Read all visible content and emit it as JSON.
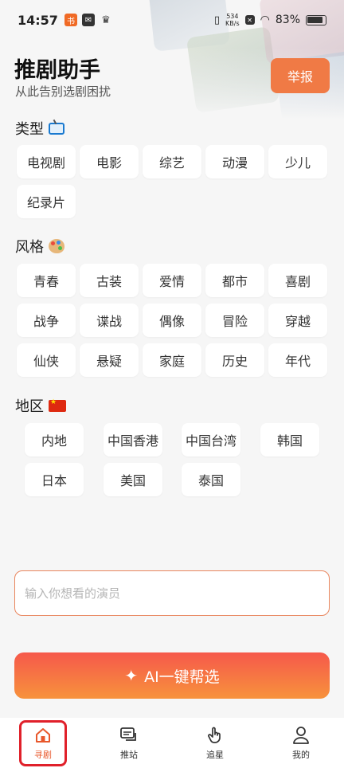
{
  "status_bar": {
    "time": "14:57",
    "net_speed_value": "534",
    "net_speed_unit": "KB/s",
    "battery": "83%"
  },
  "header": {
    "title": "推剧助手",
    "subtitle": "从此告别选剧困扰",
    "report_label": "举报"
  },
  "type_section": {
    "title": "类型",
    "icon": "tv-icon",
    "items": [
      "电视剧",
      "电影",
      "综艺",
      "动漫",
      "少儿",
      "纪录片"
    ]
  },
  "style_section": {
    "title": "风格",
    "icon": "palette-icon",
    "items": [
      "青春",
      "古装",
      "爱情",
      "都市",
      "喜剧",
      "战争",
      "谍战",
      "偶像",
      "冒险",
      "穿越",
      "仙侠",
      "悬疑",
      "家庭",
      "历史",
      "年代"
    ]
  },
  "region_section": {
    "title": "地区",
    "icon": "china-flag-icon",
    "items": [
      "内地",
      "中国香港",
      "中国台湾",
      "韩国",
      "日本",
      "美国",
      "泰国"
    ]
  },
  "actor_input": {
    "placeholder": "输入你想看的演员",
    "value": ""
  },
  "ai_button": {
    "label": "AI一键帮选",
    "icon": "sparkle-icon"
  },
  "tab_bar": {
    "items": [
      {
        "label": "寻剧",
        "icon": "home-icon",
        "active": true
      },
      {
        "label": "推站",
        "icon": "chat-icon",
        "active": false
      },
      {
        "label": "追星",
        "icon": "hand-icon",
        "active": false
      },
      {
        "label": "我的",
        "icon": "user-icon",
        "active": false
      }
    ]
  },
  "colors": {
    "accent": "#f07a45",
    "active_tab": "#e8582c",
    "highlight_box": "#e0202a"
  }
}
